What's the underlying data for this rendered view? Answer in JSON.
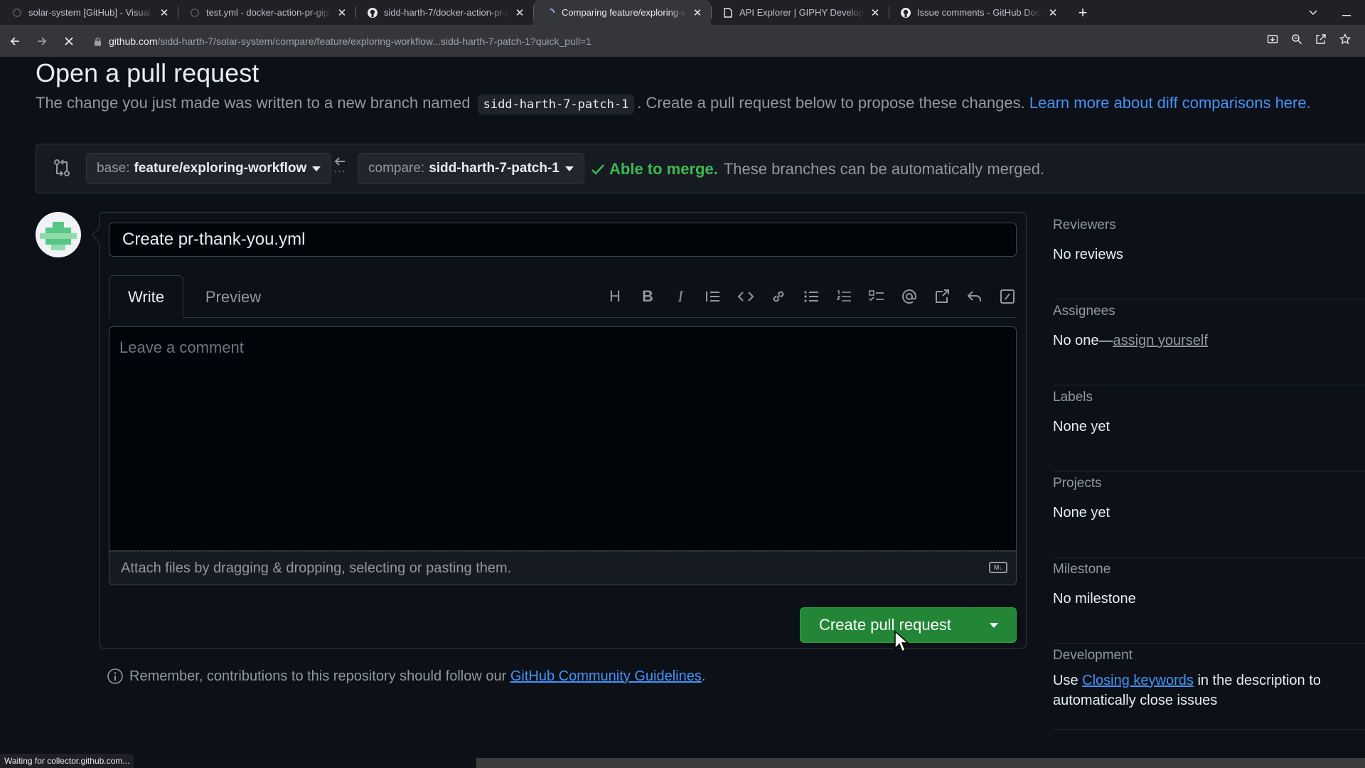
{
  "browser": {
    "tabs": [
      {
        "title": "solar-system [GitHub] - Visual St",
        "active": false
      },
      {
        "title": "test.yml - docker-action-pr-giph",
        "active": false
      },
      {
        "title": "sidd-harth-7/docker-action-pr-g",
        "active": false
      },
      {
        "title": "Comparing feature/exploring-w",
        "active": true
      },
      {
        "title": "API Explorer | GIPHY Developers",
        "active": false
      },
      {
        "title": "Issue comments - GitHub Docs",
        "active": false
      }
    ],
    "close_glyph": "✕",
    "new_tab_glyph": "+",
    "url_host": "github.com",
    "url_path": "/sidd-harth-7/solar-system/compare/feature/exploring-workflow...sidd-harth-7-patch-1?quick_pull=1",
    "status_text": "Waiting for collector.github.com..."
  },
  "page": {
    "title": "Open a pull request",
    "subtitle_before": "The change you just made was written to a new branch named",
    "branch_name": "sidd-harth-7-patch-1",
    "subtitle_after": ". Create a pull request below to propose these changes.",
    "learn_link": "Learn more about diff comparisons here."
  },
  "range": {
    "base_label": "base:",
    "base_value": "feature/exploring-workflow",
    "compare_label": "compare:",
    "compare_value": "sidd-harth-7-patch-1",
    "merge_status": "Able to merge.",
    "merge_detail": "These branches can be automatically merged."
  },
  "composer": {
    "title_value": "Create pr-thank-you.yml",
    "tab_write": "Write",
    "tab_preview": "Preview",
    "comment_placeholder": "Leave a comment",
    "attach_text": "Attach files by dragging & dropping, selecting or pasting them.",
    "md_badge": "M↓",
    "create_button": "Create pull request"
  },
  "guidelines": {
    "text": "Remember, contributions to this repository should follow our",
    "link": "GitHub Community Guidelines",
    "end": "."
  },
  "sidebar": {
    "reviewers": {
      "heading": "Reviewers",
      "value": "No reviews"
    },
    "assignees": {
      "heading": "Assignees",
      "value": "No one—",
      "link": "assign yourself"
    },
    "labels": {
      "heading": "Labels",
      "value": "None yet"
    },
    "projects": {
      "heading": "Projects",
      "value": "None yet"
    },
    "milestone": {
      "heading": "Milestone",
      "value": "No milestone"
    },
    "development": {
      "heading": "Development",
      "before": "Use",
      "link": "Closing keywords",
      "after": "in the description to automatically close issues"
    }
  },
  "colors": {
    "background": "#0d1117",
    "accent_green": "#238636",
    "link_blue": "#4493f8",
    "success": "#3fb950"
  }
}
